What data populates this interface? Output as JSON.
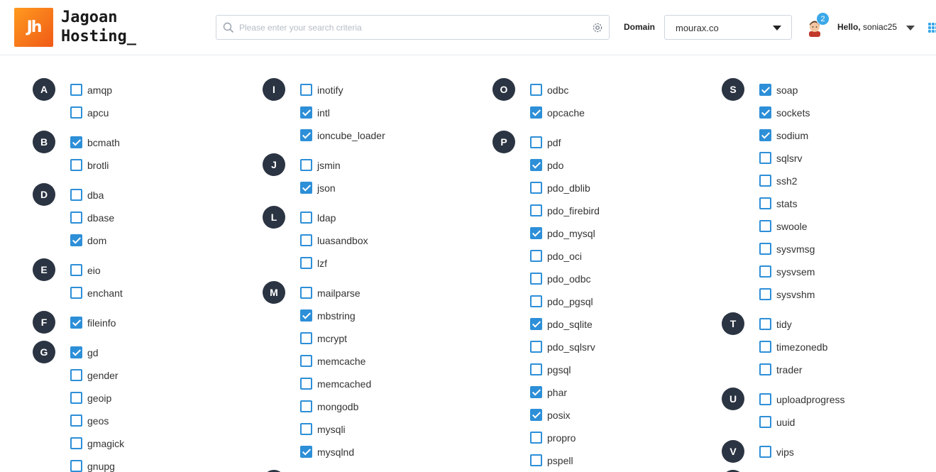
{
  "header": {
    "logo_mark": "Jh",
    "logo_line1": "Jagoan",
    "logo_line2": "Hosting_",
    "search_placeholder": "Please enter your search criteria",
    "domain_label": "Domain",
    "domain_value": "mourax.co",
    "notification_count": "2",
    "hello_prefix": "Hello,",
    "username": "soniac25",
    "accent_color": "#3aa8e8",
    "brand_color": "#f26a1b"
  },
  "columns": [
    {
      "groups": [
        {
          "letter": "A",
          "items": [
            {
              "name": "amqp",
              "checked": false
            },
            {
              "name": "apcu",
              "checked": false
            }
          ]
        },
        {
          "letter": "B",
          "items": [
            {
              "name": "bcmath",
              "checked": true
            },
            {
              "name": "brotli",
              "checked": false
            }
          ]
        },
        {
          "letter": "D",
          "items": [
            {
              "name": "dba",
              "checked": false
            },
            {
              "name": "dbase",
              "checked": false
            },
            {
              "name": "dom",
              "checked": true
            }
          ]
        },
        {
          "letter": "E",
          "items": [
            {
              "name": "eio",
              "checked": false
            },
            {
              "name": "enchant",
              "checked": false
            }
          ]
        },
        {
          "letter": "F",
          "items": [
            {
              "name": "fileinfo",
              "checked": true
            }
          ]
        },
        {
          "letter": "G",
          "items": [
            {
              "name": "gd",
              "checked": true
            },
            {
              "name": "gender",
              "checked": false
            },
            {
              "name": "geoip",
              "checked": false
            },
            {
              "name": "geos",
              "checked": false
            },
            {
              "name": "gmagick",
              "checked": false
            },
            {
              "name": "gnupg",
              "checked": false
            }
          ]
        }
      ]
    },
    {
      "groups": [
        {
          "letter": "I",
          "items": [
            {
              "name": "inotify",
              "checked": false
            },
            {
              "name": "intl",
              "checked": true
            },
            {
              "name": "ioncube_loader",
              "checked": true
            }
          ]
        },
        {
          "letter": "J",
          "items": [
            {
              "name": "jsmin",
              "checked": false
            },
            {
              "name": "json",
              "checked": true
            }
          ]
        },
        {
          "letter": "L",
          "items": [
            {
              "name": "ldap",
              "checked": false
            },
            {
              "name": "luasandbox",
              "checked": false
            },
            {
              "name": "lzf",
              "checked": false
            }
          ]
        },
        {
          "letter": "M",
          "items": [
            {
              "name": "mailparse",
              "checked": false
            },
            {
              "name": "mbstring",
              "checked": true
            },
            {
              "name": "mcrypt",
              "checked": false
            },
            {
              "name": "memcache",
              "checked": false
            },
            {
              "name": "memcached",
              "checked": false
            },
            {
              "name": "mongodb",
              "checked": false
            },
            {
              "name": "mysqli",
              "checked": false
            },
            {
              "name": "mysqlnd",
              "checked": true
            }
          ]
        },
        {
          "letter": "",
          "items": []
        }
      ]
    },
    {
      "groups": [
        {
          "letter": "O",
          "items": [
            {
              "name": "odbc",
              "checked": false
            },
            {
              "name": "opcache",
              "checked": true
            }
          ]
        },
        {
          "letter": "P",
          "items": [
            {
              "name": "pdf",
              "checked": false
            },
            {
              "name": "pdo",
              "checked": true
            },
            {
              "name": "pdo_dblib",
              "checked": false
            },
            {
              "name": "pdo_firebird",
              "checked": false
            },
            {
              "name": "pdo_mysql",
              "checked": true
            },
            {
              "name": "pdo_oci",
              "checked": false
            },
            {
              "name": "pdo_odbc",
              "checked": false
            },
            {
              "name": "pdo_pgsql",
              "checked": false
            },
            {
              "name": "pdo_sqlite",
              "checked": true
            },
            {
              "name": "pdo_sqlsrv",
              "checked": false
            },
            {
              "name": "pgsql",
              "checked": false
            },
            {
              "name": "phar",
              "checked": true
            },
            {
              "name": "posix",
              "checked": true
            },
            {
              "name": "propro",
              "checked": false
            },
            {
              "name": "pspell",
              "checked": false
            }
          ]
        }
      ]
    },
    {
      "groups": [
        {
          "letter": "S",
          "items": [
            {
              "name": "soap",
              "checked": true
            },
            {
              "name": "sockets",
              "checked": true
            },
            {
              "name": "sodium",
              "checked": true
            },
            {
              "name": "sqlsrv",
              "checked": false
            },
            {
              "name": "ssh2",
              "checked": false
            },
            {
              "name": "stats",
              "checked": false
            },
            {
              "name": "swoole",
              "checked": false
            },
            {
              "name": "sysvmsg",
              "checked": false
            },
            {
              "name": "sysvsem",
              "checked": false
            },
            {
              "name": "sysvshm",
              "checked": false
            }
          ]
        },
        {
          "letter": "T",
          "items": [
            {
              "name": "tidy",
              "checked": false
            },
            {
              "name": "timezonedb",
              "checked": false
            },
            {
              "name": "trader",
              "checked": false
            }
          ]
        },
        {
          "letter": "U",
          "items": [
            {
              "name": "uploadprogress",
              "checked": false
            },
            {
              "name": "uuid",
              "checked": false
            }
          ]
        },
        {
          "letter": "V",
          "items": [
            {
              "name": "vips",
              "checked": false
            }
          ]
        },
        {
          "letter": "",
          "items": []
        }
      ]
    }
  ]
}
